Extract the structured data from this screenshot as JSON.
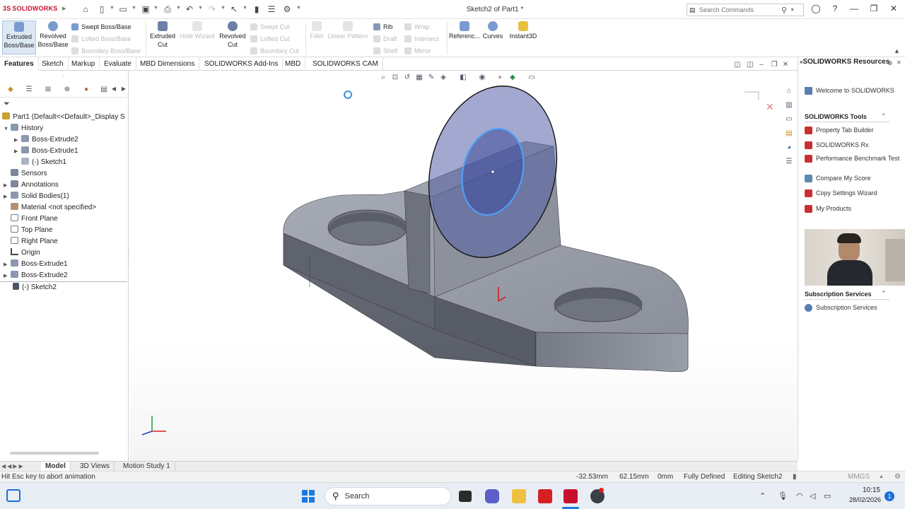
{
  "app": {
    "logo_text": "SOLIDWORKS",
    "window_title": "Sketch2 of Part1 *",
    "search_placeholder": "Search Commands"
  },
  "commands": {
    "extruded_boss": "Extruded Boss/Base",
    "revolved_boss": "Revolved Boss/Base",
    "swept_boss": "Swept Boss/Base",
    "lofted_boss": "Lofted Boss/Base",
    "boundary_boss": "Boundary Boss/Base",
    "extruded_cut": "Extruded Cut",
    "hole_wizard": "Hole Wizard",
    "revolved_cut": "Revolved Cut",
    "swept_cut": "Swept Cut",
    "lofted_cut": "Lofted Cut",
    "boundary_cut": "Boundary Cut",
    "fillet": "Fillet",
    "linear_pattern": "Linear Pattern",
    "rib": "Rib",
    "draft": "Draft",
    "shell": "Shell",
    "wrap": "Wrap",
    "intersect": "Intersect",
    "mirror": "Mirror",
    "reference": "Referenc...",
    "curves": "Curves",
    "instant3d": "Instant3D"
  },
  "tabs": [
    "Features",
    "Sketch",
    "Markup",
    "Evaluate",
    "MBD Dimensions",
    "SOLIDWORKS Add-Ins",
    "MBD",
    "SOLIDWORKS CAM"
  ],
  "tree": {
    "root": "Part1  (Default<<Default>_Display S",
    "items": [
      {
        "label": "History",
        "indent": 1
      },
      {
        "label": "Boss-Extrude2",
        "indent": 2
      },
      {
        "label": "Boss-Extrude1",
        "indent": 2
      },
      {
        "label": "(-) Sketch1",
        "indent": 2
      },
      {
        "label": "Sensors",
        "indent": 1
      },
      {
        "label": "Annotations",
        "indent": 1
      },
      {
        "label": "Solid Bodies(1)",
        "indent": 1
      },
      {
        "label": "Material <not specified>",
        "indent": 1
      },
      {
        "label": "Front Plane",
        "indent": 1
      },
      {
        "label": "Top Plane",
        "indent": 1
      },
      {
        "label": "Right Plane",
        "indent": 1
      },
      {
        "label": "Origin",
        "indent": 1
      },
      {
        "label": "Boss-Extrude1",
        "indent": 1
      },
      {
        "label": "Boss-Extrude2",
        "indent": 1
      },
      {
        "label": "(-) Sketch2",
        "indent": 1
      }
    ]
  },
  "taskpane": {
    "title": "SOLIDWORKS Resources",
    "welcome": "Welcome to SOLIDWORKS",
    "tools_header": "SOLIDWORKS Tools",
    "tools": [
      "Property Tab Builder",
      "SOLIDWORKS Rx",
      "Performance Benchmark Test",
      "Compare My Score",
      "Copy Settings Wizard",
      "My Products"
    ],
    "subscription_header": "Subscription Services",
    "subscription_item": "Subscription Services"
  },
  "bottom_tabs": [
    "Model",
    "3D Views",
    "Motion Study 1"
  ],
  "status": {
    "message": "Hit Esc key to abort animation",
    "x": "-32.53mm",
    "y": "62.15mm",
    "z": "0mm",
    "state": "Fully Defined",
    "editing": "Editing Sketch2",
    "units": "MMGS"
  },
  "taskbar": {
    "search": "Search",
    "time": "10:15",
    "date": "28/02/2026",
    "notification_count": "1"
  },
  "colors": {
    "accent": "#c8102e",
    "model_gray": "#8b8f99",
    "sketch_blue": "#4da3ff",
    "taskbar_bg": "#e9eef5"
  }
}
